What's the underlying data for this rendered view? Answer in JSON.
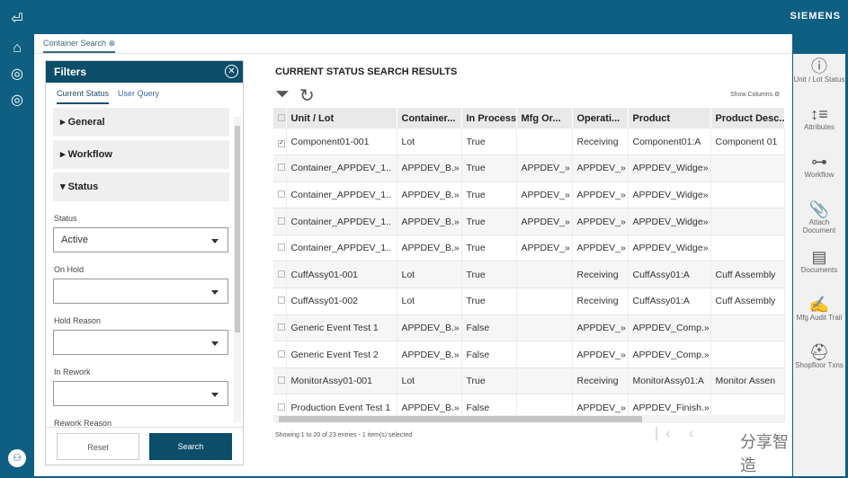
{
  "brand": "SIEMENS",
  "tab": {
    "label": "Container Search"
  },
  "filters": {
    "title": "Filters",
    "tabs": [
      "Current Status",
      "User Query"
    ],
    "sections": [
      "General",
      "Workflow",
      "Status"
    ],
    "fields": [
      {
        "label": "Status",
        "value": "Active"
      },
      {
        "label": "On Hold",
        "value": ""
      },
      {
        "label": "Hold Reason",
        "value": ""
      },
      {
        "label": "In Rework",
        "value": ""
      },
      {
        "label": "Rework Reason",
        "value": ""
      }
    ],
    "reset": "Reset",
    "search": "Search"
  },
  "results": {
    "title": "CURRENT STATUS SEARCH RESULTS",
    "show_columns": "Show Columns",
    "columns": [
      "Unit / Lot",
      "Container...",
      "In Process",
      "Mfg Or...",
      "Operati...",
      "Product",
      "Product Desc..."
    ],
    "rows": [
      [
        "Component01-001",
        "Lot",
        "True",
        "",
        "Receiving",
        "Component01:A",
        "Component 01"
      ],
      [
        "Container_APPDEV_1..",
        "APPDEV_B.»",
        "True",
        "APPDEV_»",
        "APPDEV_»",
        "APPDEV_Widge»",
        ""
      ],
      [
        "Container_APPDEV_1..",
        "APPDEV_B.»",
        "True",
        "APPDEV_»",
        "APPDEV_»",
        "APPDEV_Widge»",
        ""
      ],
      [
        "Container_APPDEV_1..",
        "APPDEV_B.»",
        "True",
        "APPDEV_»",
        "APPDEV_»",
        "APPDEV_Widge»",
        ""
      ],
      [
        "Container_APPDEV_1..",
        "APPDEV_B.»",
        "True",
        "APPDEV_»",
        "APPDEV_»",
        "APPDEV_Widge»",
        ""
      ],
      [
        "CuffAssy01-001",
        "Lot",
        "True",
        "",
        "Receiving",
        "CuffAssy01:A",
        "Cuff Assembly"
      ],
      [
        "CuffAssy01-002",
        "Lot",
        "True",
        "",
        "Receiving",
        "CuffAssy01:A",
        "Cuff Assembly"
      ],
      [
        "Generic Event Test 1",
        "APPDEV_B.»",
        "False",
        "",
        "APPDEV_»",
        "APPDEV_Comp.»",
        ""
      ],
      [
        "Generic Event Test 2",
        "APPDEV_B.»",
        "False",
        "",
        "APPDEV_»",
        "APPDEV_Comp.»",
        ""
      ],
      [
        "MonitorAssy01-001",
        "Lot",
        "True",
        "",
        "Receiving",
        "MonitorAssy01:A",
        "Monitor Assen"
      ],
      [
        "Production Event Test 1",
        "APPDEV_B.»",
        "False",
        "",
        "APPDEV_»",
        "APPDEV_Finish.»",
        ""
      ]
    ],
    "checked": [
      0
    ],
    "status": "Showing 1 to 20 of 23 entries  -  1  item(s) selected"
  },
  "watermark": "分享智造",
  "right_toolbar": [
    {
      "label": "Unit / Lot Status",
      "icon": "ⓘ"
    },
    {
      "label": "Attributes",
      "icon": "↕≡"
    },
    {
      "label": "Workflow",
      "icon": "⊶"
    },
    {
      "label": "Attach Document",
      "icon": "📎"
    },
    {
      "label": "Documents",
      "icon": "▤"
    },
    {
      "label": "Mfg Audit Trail",
      "icon": "✍"
    },
    {
      "label": "Shopfloor Txns",
      "icon": "⛑"
    }
  ]
}
